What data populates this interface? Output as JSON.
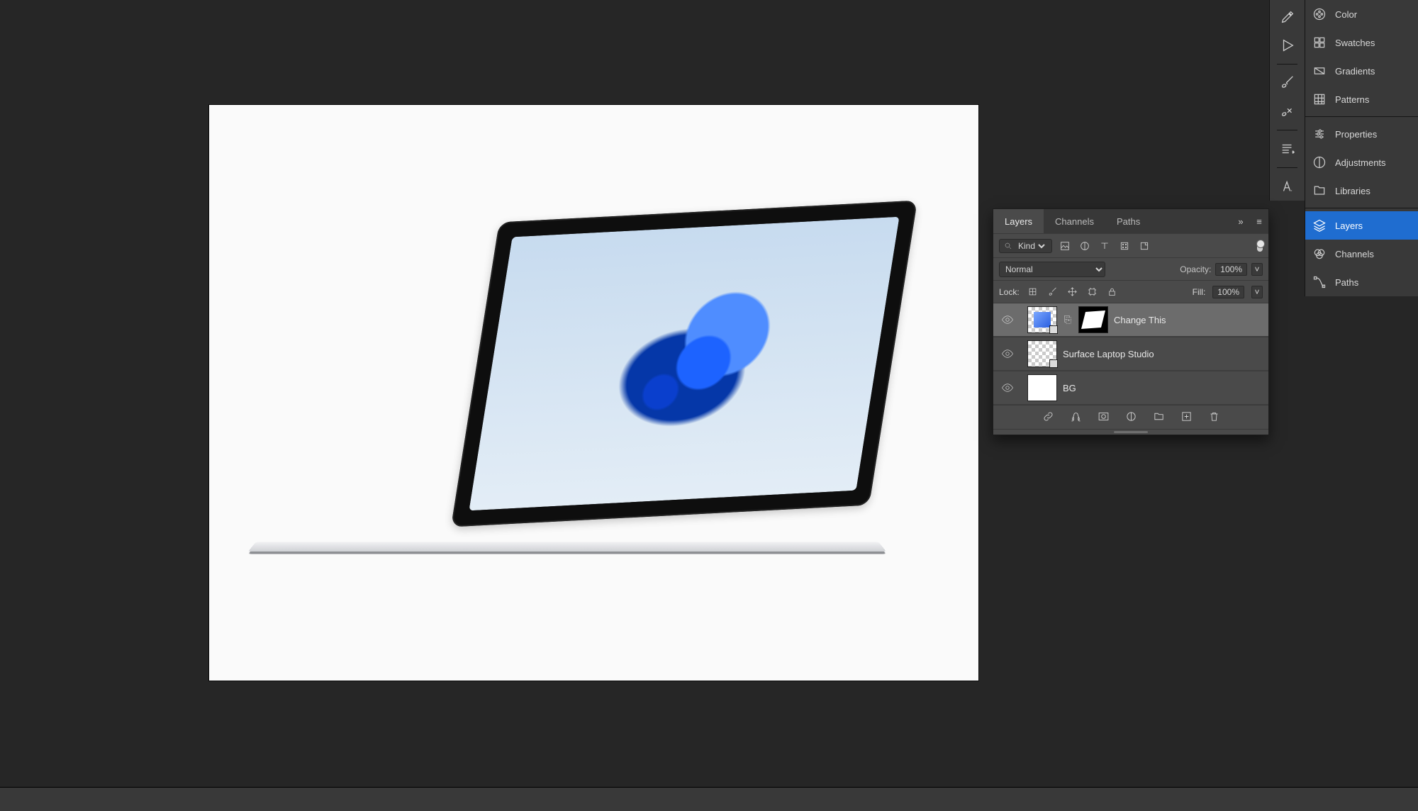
{
  "panelTabs": {
    "color": "Color",
    "swatches": "Swatches",
    "gradients": "Gradients",
    "patterns": "Patterns",
    "properties": "Properties",
    "adjustments": "Adjustments",
    "libraries": "Libraries",
    "layers": "Layers",
    "channels": "Channels",
    "paths": "Paths"
  },
  "layersPanel": {
    "tabs": {
      "layers": "Layers",
      "channels": "Channels",
      "paths": "Paths"
    },
    "filterKind": "Kind",
    "blendMode": "Normal",
    "opacityLabel": "Opacity:",
    "opacityValue": "100%",
    "lockLabel": "Lock:",
    "fillLabel": "Fill:",
    "fillValue": "100%",
    "layers": [
      {
        "name": "Change This",
        "selected": true,
        "smart": true,
        "mask": true
      },
      {
        "name": "Surface Laptop Studio",
        "selected": false,
        "smart": true,
        "mask": false
      },
      {
        "name": "BG",
        "selected": false,
        "smart": false,
        "mask": false
      }
    ]
  }
}
